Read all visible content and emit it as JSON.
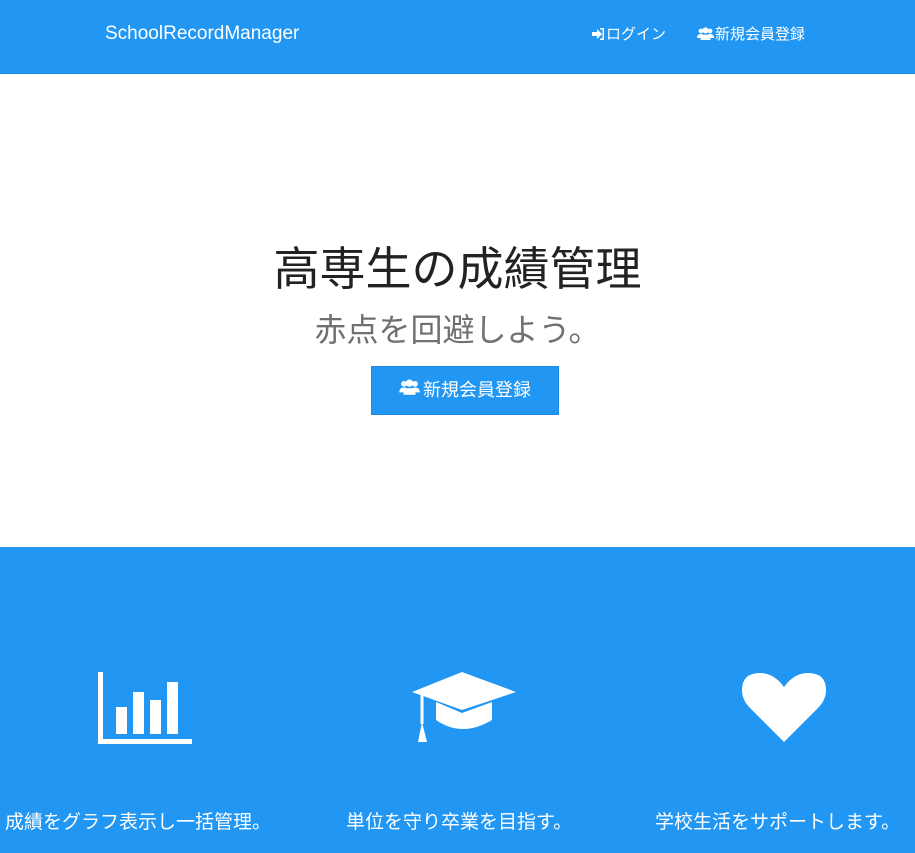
{
  "navbar": {
    "brand": "SchoolRecordManager",
    "login_label": "ログイン",
    "register_label": "新規会員登録",
    "login_icon": "sign-in-icon",
    "register_icon": "users-icon"
  },
  "hero": {
    "title": "高専生の成績管理",
    "subtitle": "赤点を回避しよう。",
    "button_label": "新規会員登録",
    "button_icon": "users-icon"
  },
  "features": [
    {
      "icon": "bar-chart-icon",
      "text": "成績をグラフ表示し一括管理。"
    },
    {
      "icon": "graduation-cap-icon",
      "text": "単位を守り卒業を目指す。"
    },
    {
      "icon": "heart-icon",
      "text": "学校生活をサポートします。"
    }
  ],
  "colors": {
    "primary": "#2196f3",
    "white": "#ffffff",
    "title_text": "#222222",
    "subtitle_text": "#707070"
  }
}
